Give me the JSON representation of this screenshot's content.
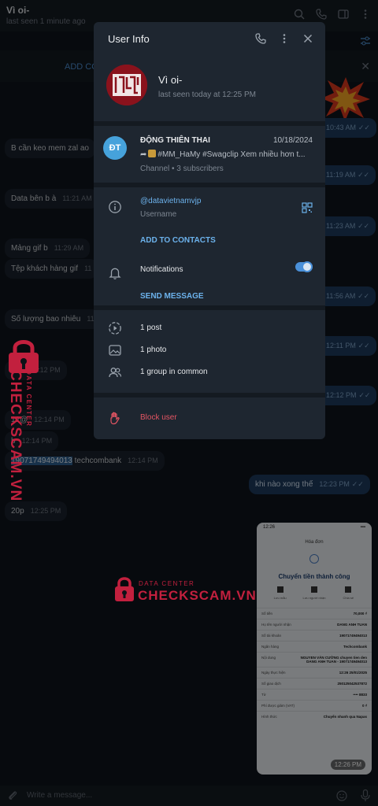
{
  "chat": {
    "title": "Vì oi-",
    "subtitle": "last seen 1 minute ago",
    "pinned_action": "ADD CO",
    "input_placeholder": "Write a message...",
    "messages": [
      {
        "text": "B cần keo mem zal ao",
        "time": ""
      },
      {
        "text": "Data bên b à",
        "time": "11:21 AM"
      },
      {
        "text": "Mảng gif b",
        "time": "11:29 AM"
      },
      {
        "text": "Tệp khách hàng gif",
        "time": "11"
      },
      {
        "text": "Số lượng bao nhiêu",
        "time": "11"
      },
      {
        "text": "70k",
        "time": "12:12 PM"
      },
      {
        "text": "12@",
        "time": "12:14 PM"
      },
      {
        "text": "b",
        "time": "12:14 PM"
      },
      {
        "account": "19071749494013",
        "text": "techcombank",
        "time": "12:14 PM"
      },
      {
        "text": "20p",
        "time": "12:25 PM"
      }
    ],
    "outgoing": [
      {
        "time": "10:43 AM"
      },
      {
        "time": "11:19 AM"
      },
      {
        "time": "11:23 AM"
      },
      {
        "time": "11:56 AM"
      },
      {
        "time": "12:11 PM"
      },
      {
        "time": "12:12 PM"
      },
      {
        "text": "khi nào xong thế",
        "time": "12:23 PM"
      }
    ],
    "receipt": {
      "clock": "12:26",
      "title": "Hóa đơn",
      "headline": "Chuyển tiền thành công",
      "actions": [
        "Lưu mẫu",
        "Lưu người nhận",
        "Chia sẻ"
      ],
      "rows": [
        {
          "k": "Số tiền",
          "v": "70,000 ₫"
        },
        {
          "k": "Họ tên người nhận",
          "v": "DANG ANH TUAN"
        },
        {
          "k": "Số tài khoản",
          "v": "19071749494013"
        },
        {
          "k": "Ngân hàng",
          "v": "Techcombank"
        },
        {
          "k": "Nội dung",
          "v": "NGUYEN VĂN CƯỜNG chuyen tien den DANG ANH TUAN - 19071749494013"
        },
        {
          "k": "Ngày thực hiện",
          "v": "12:26 25/01/2025"
        },
        {
          "k": "Số giao dịch",
          "v": "250125042537872"
        },
        {
          "k": "Từ",
          "v": "•••• 8833"
        },
        {
          "k": "Phí được giảm (VAT)",
          "v": "0 ₫"
        },
        {
          "k": "Hình thức",
          "v": "Chuyển nhanh qua Napas"
        }
      ],
      "time": "12:26 PM"
    }
  },
  "watermark": {
    "tag": "DATA CENTER",
    "brand": "CHECKSCAM.VN",
    "color": "#c2203e"
  },
  "panel": {
    "title": "User Info",
    "user": {
      "name": "Vì oi-",
      "status": "last seen today at 12:25 PM"
    },
    "channel": {
      "initials": "ĐT",
      "name": "ĐỘNG THIÊN THAI",
      "date": "10/18/2024",
      "preview": "#MM_HaMy #Swagclip  Xem nhiều hơn t...",
      "meta": "Channel • 3 subscribers"
    },
    "username": "@datavietnamvjp",
    "username_label": "Username",
    "add_contacts": "ADD TO CONTACTS",
    "notifications": "Notifications",
    "notifications_on": true,
    "send_message": "SEND MESSAGE",
    "media": [
      "1 post",
      "1 photo",
      "1 group in common"
    ],
    "block": "Block user"
  },
  "colors": {
    "accent": "#6cb2ec",
    "danger": "#e45563",
    "panel_bg": "#1e2630"
  }
}
